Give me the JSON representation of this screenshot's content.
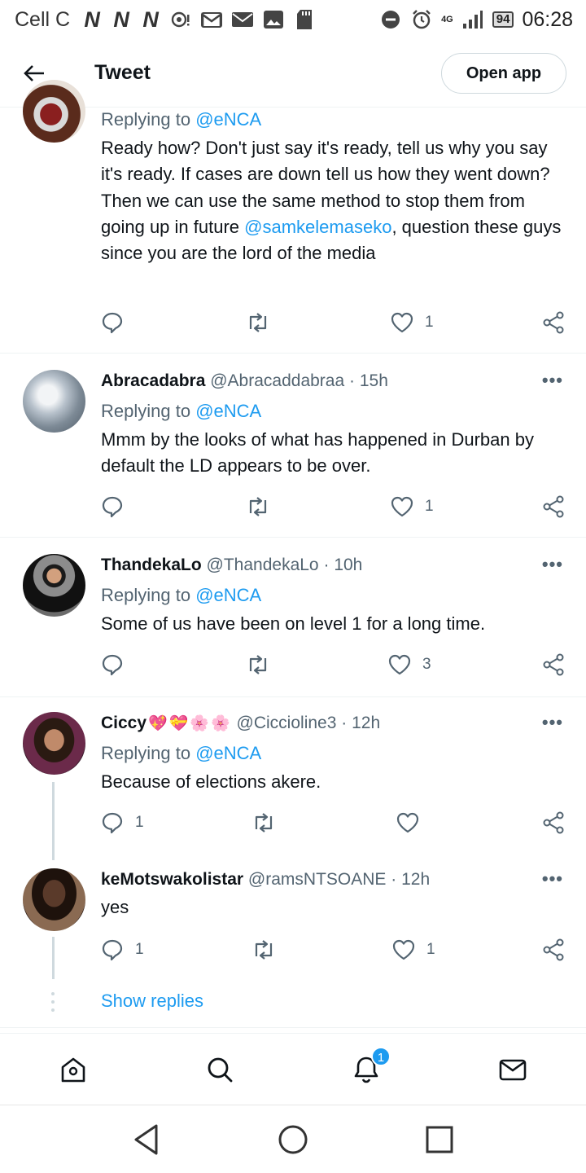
{
  "status_bar": {
    "carrier": "Cell C",
    "network_letters": [
      "N",
      "N",
      "N"
    ],
    "network_type": "4G",
    "battery": "94",
    "time": "06:28"
  },
  "header": {
    "title": "Tweet",
    "open_app_label": "Open app"
  },
  "tweets": [
    {
      "reply_prefix": "Replying to",
      "reply_to": "@eNCA",
      "text_1": "Ready how?  Don't just say it's ready, tell us why you say it's ready. If cases are down tell us how they went down? Then we can use the same method to stop them from going up in future ",
      "mention": "@samkelemaseko",
      "text_2": ", question these guys since you are the lord of the media",
      "replies": "",
      "likes": "1"
    },
    {
      "name": "Abracadabra",
      "handle": "@Abracaddabraa",
      "time": "15h",
      "reply_prefix": "Replying to",
      "reply_to": "@eNCA",
      "text": "Mmm by the looks of what has happened in Durban by default the LD appears to be over.",
      "replies": "",
      "likes": "1"
    },
    {
      "name": "ThandekaLo",
      "handle": "@ThandekaLo",
      "time": "10h",
      "reply_prefix": "Replying to",
      "reply_to": "@eNCA",
      "text": "Some of us have been on level 1 for a long time.",
      "replies": "",
      "likes": "3"
    },
    {
      "name": "Ciccy",
      "name_emoji": "💖💝🌸🌸",
      "handle": "@Ciccioline3",
      "time": "12h",
      "reply_prefix": "Replying to",
      "reply_to": "@eNCA",
      "text": "Because of elections akere.",
      "replies": "1",
      "likes": ""
    },
    {
      "name": "keMotswakolistar",
      "handle": "@ramsNTSOANE",
      "time": "12h",
      "text": "yes",
      "replies": "1",
      "likes": "1"
    }
  ],
  "separator": "·",
  "more_label": "•••",
  "show_replies": "Show replies",
  "bottom_nav": {
    "items": [
      "home-icon",
      "search-icon",
      "notifications-icon",
      "messages-icon"
    ],
    "notification_badge": "1"
  },
  "colors": {
    "accent": "#1d9bf0",
    "text": "#0f1419",
    "secondary": "#536471",
    "divider": "#eff3f4"
  }
}
